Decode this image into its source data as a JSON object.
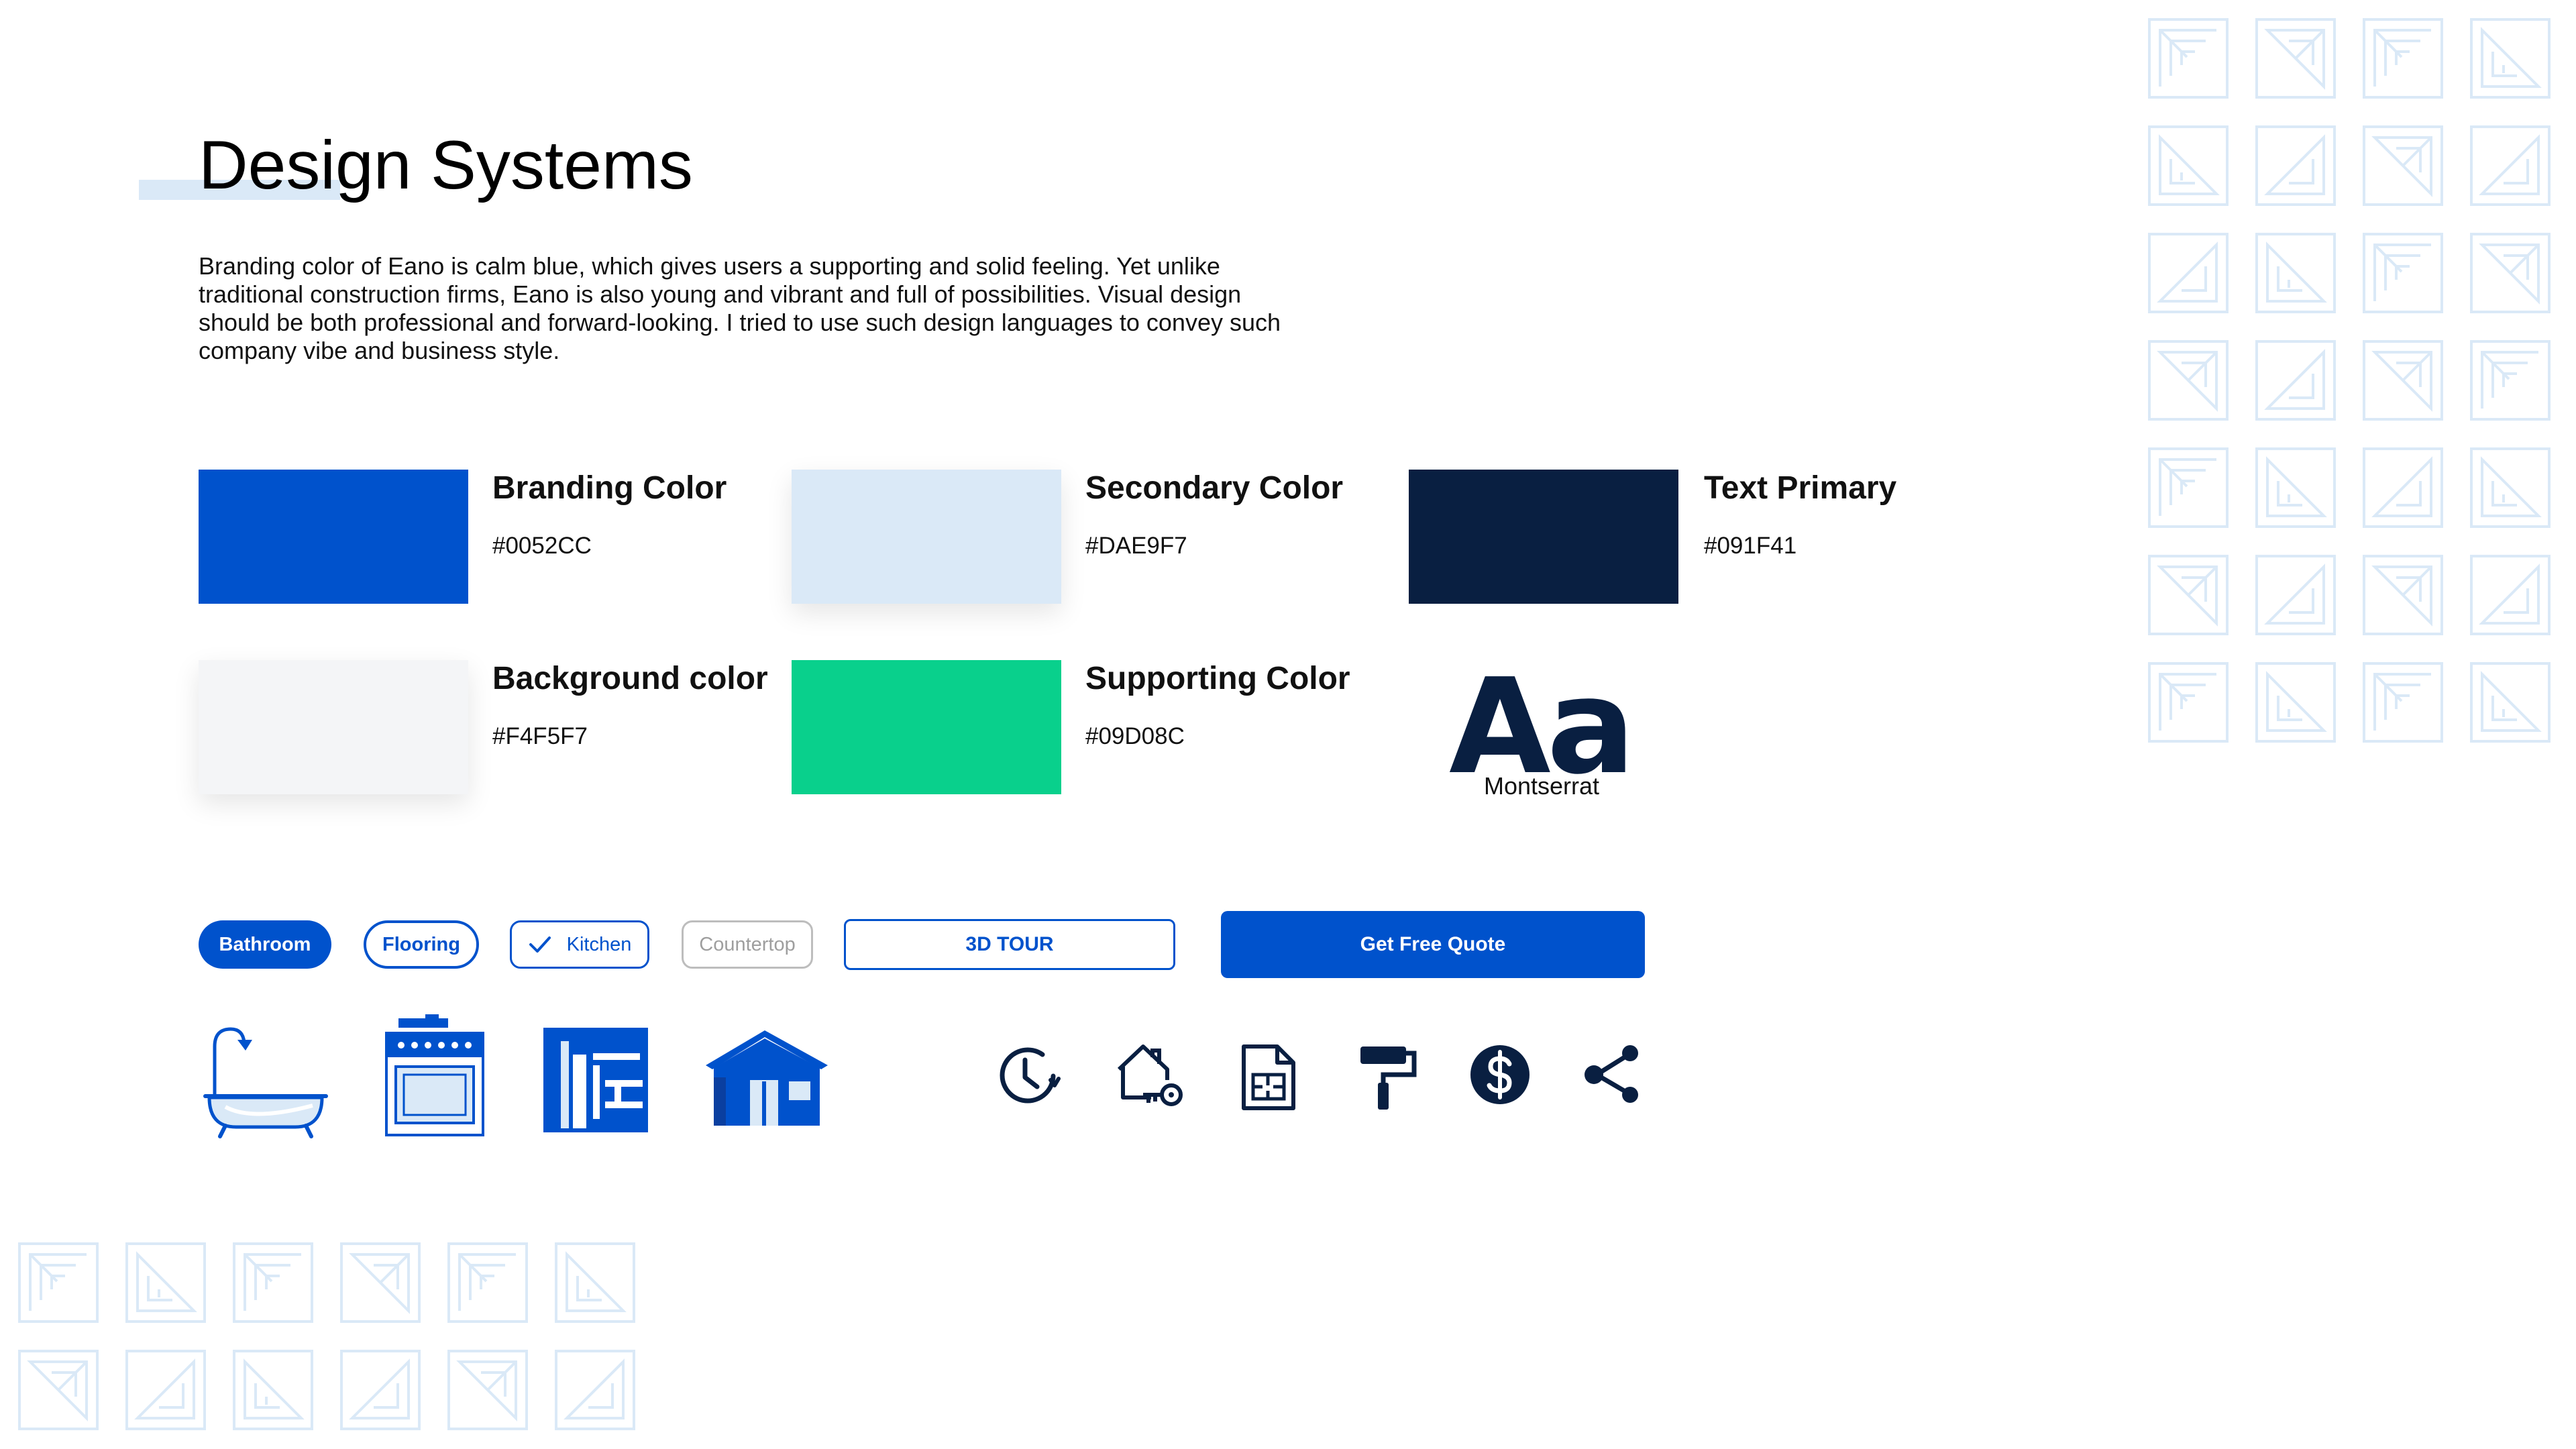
{
  "page": {
    "title": "Design Systems",
    "intro": "Branding color of Eano is calm blue, which gives users a supporting and solid feeling. Yet unlike traditional construction firms, Eano is also young and vibrant and full of possibilities. Visual design should be both professional and forward-looking. I tried to use such design languages to convey such company vibe and business style."
  },
  "colors": [
    {
      "name": "Branding Color",
      "hex": "#0052CC"
    },
    {
      "name": "Secondary Color",
      "hex": "#DAE9F7"
    },
    {
      "name": "Text Primary",
      "hex": "#091F41"
    },
    {
      "name": "Background color",
      "hex": "#F4F5F7"
    },
    {
      "name": "Supporting Color",
      "hex": "#09D08C"
    }
  ],
  "typography": {
    "sample": "Aa",
    "font_name": "Montserrat"
  },
  "chips": {
    "bathroom": "Bathroom",
    "flooring": "Flooring",
    "kitchen": "Kitchen",
    "countertop": "Countertop"
  },
  "buttons": {
    "tour": "3D TOUR",
    "quote": "Get Free Quote"
  },
  "illustrations": [
    "bathtub-icon",
    "stove-icon",
    "flooring-icon",
    "house-icon"
  ],
  "icons": [
    "clock-icon",
    "house-key-icon",
    "floorplan-document-icon",
    "paint-roller-icon",
    "dollar-icon",
    "share-icon"
  ],
  "pattern_color": "#DAE9F7"
}
